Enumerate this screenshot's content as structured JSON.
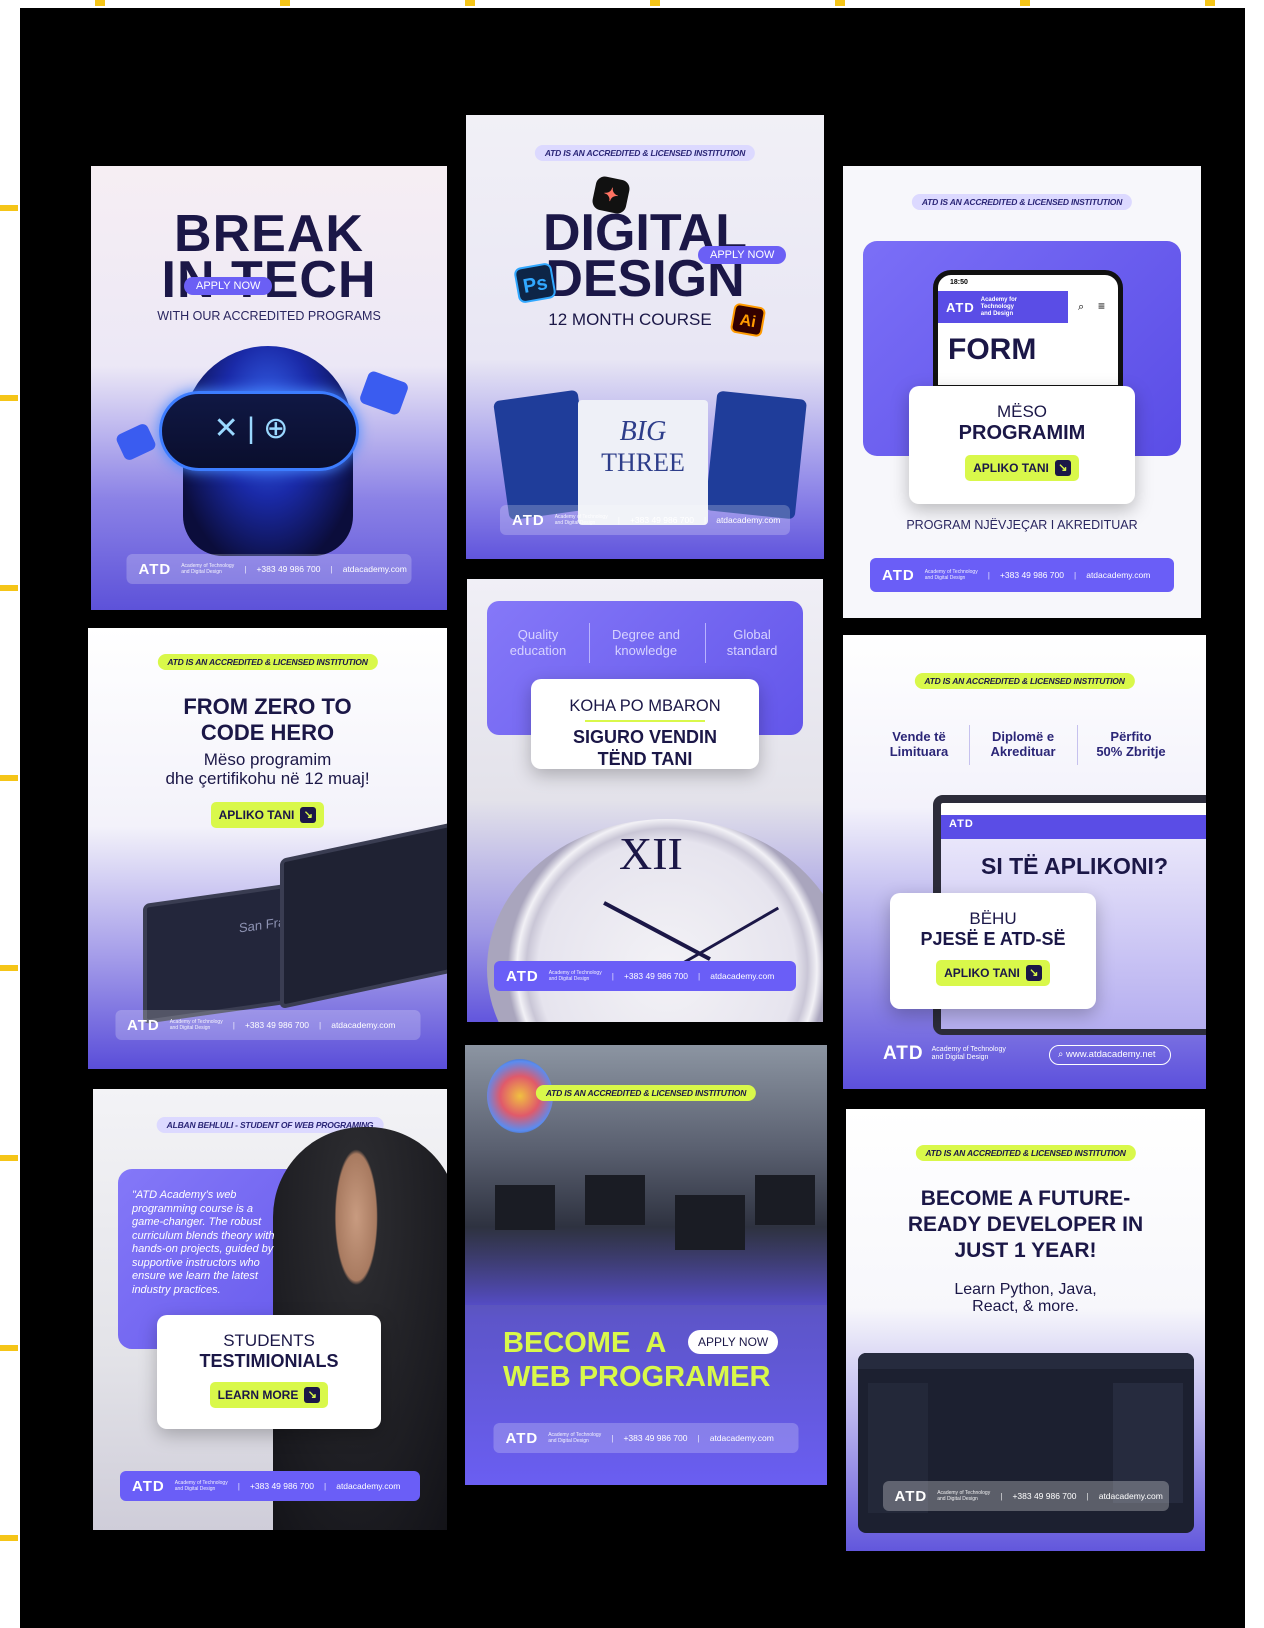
{
  "brand": {
    "logo": "ATD",
    "logo_sub1": "Academy of Technology",
    "logo_sub2": "and Digital Design",
    "phone": "+383 49 986 700",
    "site": "atdacademy.com",
    "site_net": "www.atdacademy.net",
    "accredited": "ATD IS AN ACCREDITED & LICENSED INSTITUTION"
  },
  "colors": {
    "board": "#000000",
    "purple": "#6a5ef7",
    "lime": "#d9f84a",
    "navy": "#1b1747"
  },
  "cards": {
    "break_tech": {
      "line1": "BREAK",
      "line2": "IN TECH",
      "pill": "APPLY NOW",
      "subtitle": "WITH OUR ACCREDITED PROGRAMS"
    },
    "digital_design": {
      "line1": "DIGITAL",
      "line2": "DESIGN",
      "pill": "APPLY NOW",
      "subtitle": "12 MONTH COURSE",
      "ps": "Ps",
      "ai": "Ai",
      "book1": "BIG",
      "book2": "THREE"
    },
    "programim": {
      "phone_time": "18:50",
      "phone_brand1": "Academy for",
      "phone_brand2": "Technology",
      "phone_brand3": "and Design",
      "phone_word": "FORM",
      "line1": "MËSO",
      "line2": "PROGRAMIM",
      "cta": "APLIKO TANI",
      "tagline": "PROGRAM NJËVJEÇAR I AKREDITUAR"
    },
    "code_hero": {
      "title1": "FROM ZERO TO",
      "title2": "CODE HERO",
      "sub1": "Mëso programim",
      "sub2": "dhe çertifikohu në 12 muaj!",
      "cta": "APLIKO TANI",
      "screen_text": "San Francisco"
    },
    "koha": {
      "col1a": "Quality",
      "col1b": "education",
      "col2a": "Degree and",
      "col2b": "knowledge",
      "col3a": "Global",
      "col3b": "standard",
      "line1": "KOHA PO MBARON",
      "line2": "SIGURO VENDIN",
      "line3": "TËND TANI"
    },
    "aplikoni": {
      "col1a": "Vende të",
      "col1b": "Limituara",
      "col2a": "Diplomë e",
      "col2b": "Akredituar",
      "col3a": "Përfito",
      "col3b": "50% Zbritje",
      "headline": "SI TË APLIKONI?",
      "line1": "BËHU",
      "line2": "PJESË E ATD-SË",
      "cta": "APLIKO TANI"
    },
    "testimonial": {
      "badge": "ALBAN BEHLULI - STUDENT OF WEB PROGRAMING",
      "quote": "\"ATD Academy's web programming course is a game-changer. The robust curriculum blends theory with hands-on projects, guided by supportive instructors who ensure we learn the latest industry practices.",
      "line1": "STUDENTS",
      "line2": "TESTIMIONIALS",
      "cta": "LEARN MORE"
    },
    "web_programer": {
      "line1": "BECOME  A",
      "pill": "APPLY NOW",
      "line2": "WEB PROGRAMER"
    },
    "future_dev": {
      "title1": "BECOME A FUTURE-",
      "title2": "READY DEVELOPER IN",
      "title3": "JUST 1 YEAR!",
      "sub1": "Learn Python, Java,",
      "sub2": "React, & more."
    }
  }
}
